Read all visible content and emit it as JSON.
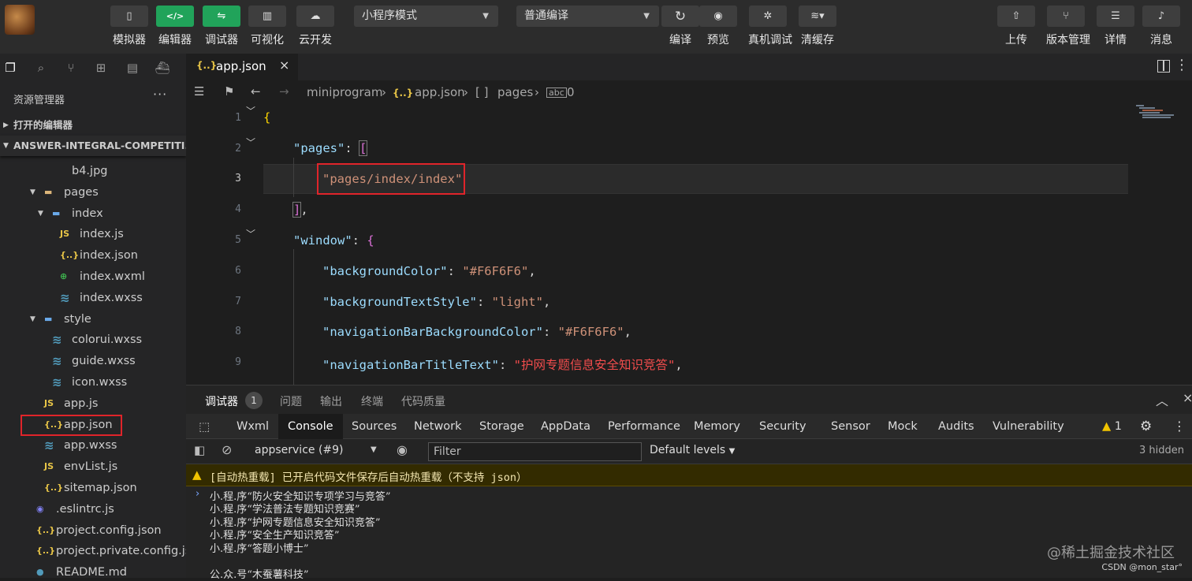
{
  "toolbar": {
    "left_buttons": [
      {
        "icon": "phone-icon",
        "glyph": "▯",
        "label": "模拟器"
      },
      {
        "icon": "code-icon",
        "glyph": "</>",
        "label": "编辑器",
        "active": true
      },
      {
        "icon": "debug-icon",
        "glyph": "⇋",
        "label": "调试器",
        "active": true
      },
      {
        "icon": "layout-icon",
        "glyph": "▥",
        "label": "可视化"
      },
      {
        "icon": "cloud-icon",
        "glyph": "☁",
        "label": "云开发"
      }
    ],
    "mode_select": "小程序模式",
    "compile_select": "普通编译",
    "mid_buttons": [
      {
        "icon": "refresh-icon",
        "glyph": "↻",
        "label": "编译"
      },
      {
        "icon": "eye-icon",
        "glyph": "◉",
        "label": "预览"
      },
      {
        "icon": "bug-icon",
        "glyph": "✲",
        "label": "真机调试"
      },
      {
        "icon": "layers-icon",
        "glyph": "≋▾",
        "label": "清缓存"
      }
    ],
    "right_buttons": [
      {
        "icon": "upload-icon",
        "glyph": "⇧",
        "label": "上传"
      },
      {
        "icon": "branch-icon",
        "glyph": "⑂",
        "label": "版本管理"
      },
      {
        "icon": "menu-icon",
        "glyph": "☰",
        "label": "详情"
      },
      {
        "icon": "bell-icon",
        "glyph": "♪",
        "label": "消息"
      }
    ]
  },
  "sidebar": {
    "title": "资源管理器",
    "more": "···",
    "open_editors": "打开的编辑器",
    "project": "ANSWER-INTEGRAL-COMPETITI...",
    "tree": [
      {
        "name": "b4.jpg",
        "type": "img",
        "depth": 2
      },
      {
        "name": "pages",
        "type": "folder",
        "depth": 1,
        "open": true
      },
      {
        "name": "index",
        "type": "folder-blue",
        "depth": 2,
        "open": true
      },
      {
        "name": "index.js",
        "type": "js",
        "depth": 3
      },
      {
        "name": "index.json",
        "type": "json",
        "depth": 3
      },
      {
        "name": "index.wxml",
        "type": "wxml",
        "depth": 3
      },
      {
        "name": "index.wxss",
        "type": "css",
        "depth": 3
      },
      {
        "name": "style",
        "type": "folder-blue",
        "depth": 1,
        "open": true
      },
      {
        "name": "colorui.wxss",
        "type": "css",
        "depth": 2
      },
      {
        "name": "guide.wxss",
        "type": "css",
        "depth": 2
      },
      {
        "name": "icon.wxss",
        "type": "css",
        "depth": 2
      },
      {
        "name": "app.js",
        "type": "js",
        "depth": 1
      },
      {
        "name": "app.json",
        "type": "json",
        "depth": 1,
        "highlight": true
      },
      {
        "name": "app.wxss",
        "type": "css",
        "depth": 1
      },
      {
        "name": "envList.js",
        "type": "js",
        "depth": 1
      },
      {
        "name": "sitemap.json",
        "type": "json",
        "depth": 1
      },
      {
        "name": ".eslintrc.js",
        "type": "eslint",
        "depth": 0
      },
      {
        "name": "project.config.json",
        "type": "json",
        "depth": 0
      },
      {
        "name": "project.private.config.js...",
        "type": "json",
        "depth": 0
      },
      {
        "name": "README.md",
        "type": "readme",
        "depth": 0
      }
    ]
  },
  "editor": {
    "tab_title": "app.json",
    "tab_close": "×",
    "breadcrumb": [
      "miniprogram",
      "app.json",
      "pages",
      "0"
    ],
    "breadcrumb_sep": "›",
    "lines": [
      "1",
      "2",
      "3",
      "4",
      "5",
      "6",
      "7",
      "8",
      "9"
    ],
    "code": {
      "l1_brace": "{",
      "l2_key": "\"pages\"",
      "l2_colon": ": ",
      "l2_bracket": "[",
      "l3_value": "\"pages/index/index\"",
      "l4_bracket": "]",
      "l4_comma": ",",
      "l5_key": "\"window\"",
      "l5_colon": ": ",
      "l5_brace": "{",
      "l6_key": "\"backgroundColor\"",
      "l6_value": "\"#F6F6F6\"",
      "l7_key": "\"backgroundTextStyle\"",
      "l7_value": "\"light\"",
      "l8_key": "\"navigationBarBackgroundColor\"",
      "l8_value": "\"#F6F6F6\"",
      "l9_key": "\"navigationBarTitleText\"",
      "l9_value": "\"护网专题信息安全知识竞答\"",
      "colon": ": ",
      "comma": ","
    }
  },
  "debugger": {
    "panel_tabs": [
      {
        "label": "调试器",
        "active": true
      },
      {
        "label": "问题"
      },
      {
        "label": "输出"
      },
      {
        "label": "终端"
      },
      {
        "label": "代码质量"
      }
    ],
    "badge": "1",
    "devtools_tabs": [
      "Wxml",
      "Console",
      "Sources",
      "Network",
      "Storage",
      "AppData",
      "Performance",
      "Memory",
      "Security",
      "Sensor",
      "Mock",
      "Audits",
      "Vulnerability"
    ],
    "active_devtools_tab": "Console",
    "warning_count": "1",
    "context": "appservice (#9)",
    "filter_placeholder": "Filter",
    "levels": "Default levels",
    "hidden": "3 hidden",
    "warning_text": "[自动热重载] 已开启代码文件保存后自动热重载（不支持 json）",
    "logs": [
      "小.程.序“防火安全知识专项学习与竞答”",
      "小.程.序“学法普法专题知识竞赛”",
      "小.程.序“护网专题信息安全知识竞答”",
      "小.程.序“安全生产知识竞答”",
      "小.程.序“答题小博士”",
      "公.众.号“木蚕薯科技”"
    ],
    "watermark": "@稀土掘金技术社区",
    "watermark2": "CSDN @mon_star°"
  },
  "colors": {
    "accent_green": "#21a35a",
    "highlight_red": "#e0242a",
    "warning_yellow": "#f0c300"
  }
}
